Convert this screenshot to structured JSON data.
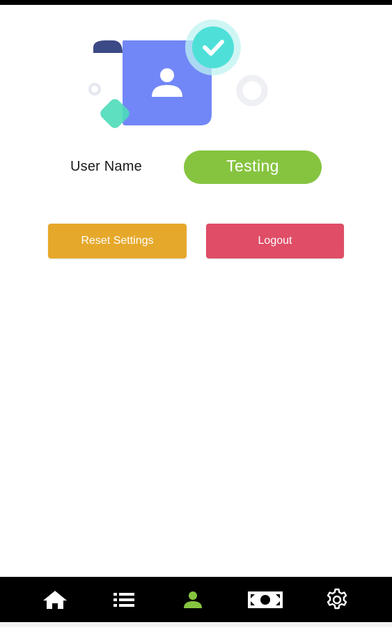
{
  "profile": {
    "username_label": "User Name",
    "username_value": "Testing"
  },
  "actions": {
    "reset_label": "Reset Settings",
    "logout_label": "Logout"
  },
  "nav": {
    "items": [
      {
        "icon": "home-icon",
        "active": false
      },
      {
        "icon": "list-icon",
        "active": false
      },
      {
        "icon": "user-icon",
        "active": true
      },
      {
        "icon": "money-icon",
        "active": false
      },
      {
        "icon": "gear-icon",
        "active": false
      }
    ]
  },
  "colors": {
    "accent_green": "#86c440",
    "reset_orange": "#e6a82a",
    "logout_red": "#df4d66",
    "card_blue": "#7287f7",
    "check_teal": "#4ee0d8",
    "nav_background": "#000000",
    "nav_active": "#86c440",
    "nav_inactive": "#ffffff"
  }
}
